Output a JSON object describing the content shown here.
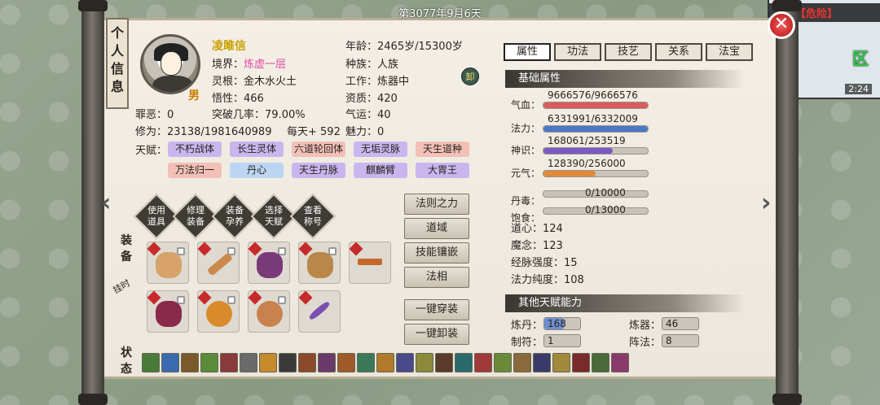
{
  "date": "第3077年9月6天",
  "minimap": {
    "area_name": "裂隙",
    "danger": "【危险】",
    "zone": "区",
    "time": "2:24"
  },
  "side_tags": {
    "info": "个人信息",
    "equip": "装备",
    "status": "状态"
  },
  "character": {
    "name": "凌雎信",
    "gender": "男",
    "realm_label": "境界：",
    "realm": "炼虚一层",
    "root_label": "灵根：",
    "root": "金木水火土",
    "comprehension_label": "悟性：",
    "comprehension": "466",
    "sin_label": "罪恶：",
    "sin": "0",
    "breakthrough_label": "突破几率：",
    "breakthrough": "79.00%",
    "cultivation_label": "修为：",
    "cultivation": "23138/1981640989",
    "per_day": "每天+ 592",
    "age_label": "年龄：",
    "age": "2465岁/15300岁",
    "race_label": "种族：",
    "race": "人族",
    "work_label": "工作：",
    "work": "炼器中",
    "aptitude_label": "资质：",
    "aptitude": "420",
    "luck_label": "气运：",
    "luck": "40",
    "charm_label": "魅力：",
    "charm": "0",
    "unequip_btn": "卸"
  },
  "talents_label": "天赋：",
  "talents": [
    {
      "name": "不朽战体",
      "color": "purple"
    },
    {
      "name": "长生灵体",
      "color": "purple"
    },
    {
      "name": "六道轮回体",
      "color": "red"
    },
    {
      "name": "无垢灵脉",
      "color": "purple"
    },
    {
      "name": "天生道种",
      "color": "red"
    },
    {
      "name": "万法归一",
      "color": "red"
    },
    {
      "name": "丹心",
      "color": "blue"
    },
    {
      "name": "天生丹脉",
      "color": "purple"
    },
    {
      "name": "麒麟臂",
      "color": "purple"
    },
    {
      "name": "大胃王",
      "color": "purple"
    }
  ],
  "diamond_buttons": [
    {
      "label": "使用道具"
    },
    {
      "label": "修理装备"
    },
    {
      "label": "装备孕养"
    },
    {
      "label": "选择天赋"
    },
    {
      "label": "查看称号"
    }
  ],
  "action_buttons": [
    "法则之力",
    "道域",
    "技能镶嵌",
    "法相",
    "一键穿装",
    "一键卸装"
  ],
  "tabs": [
    {
      "label": "属性",
      "active": true
    },
    {
      "label": "功法",
      "active": false
    },
    {
      "label": "技艺",
      "active": false
    },
    {
      "label": "关系",
      "active": false
    },
    {
      "label": "法宝",
      "active": false
    }
  ],
  "basic_title": "基础属性",
  "bars": [
    {
      "label": "气血：",
      "value": "9666576/9666576",
      "fraction": 1.0,
      "color": "#d95b5b"
    },
    {
      "label": "法力：",
      "value": "6331991/6332009",
      "fraction": 0.999,
      "color": "#4b77c9"
    },
    {
      "label": "神识：",
      "value": "168061/253519",
      "fraction": 0.663,
      "color": "#7b58c4"
    },
    {
      "label": "元气：",
      "value": "128390/256000",
      "fraction": 0.5,
      "color": "#e08a3c"
    },
    {
      "label": "丹毒：",
      "value": "0/10000",
      "fraction": 0,
      "color": "#888"
    },
    {
      "label": "饱食：",
      "value": "0/13000",
      "fraction": 0,
      "color": "#888"
    }
  ],
  "plain_stats": [
    {
      "label": "道心：",
      "value": "124"
    },
    {
      "label": "魔念：",
      "value": "123"
    },
    {
      "label": "经脉强度：",
      "value": "15"
    },
    {
      "label": "法力纯度：",
      "value": "108"
    }
  ],
  "other_title": "其他天赋能力",
  "skills": [
    {
      "label": "炼丹：",
      "value": "168",
      "fraction": 0.55
    },
    {
      "label": "炼器：",
      "value": "46",
      "fraction": 0
    },
    {
      "label": "制符：",
      "value": "1",
      "fraction": 0
    },
    {
      "label": "阵法：",
      "value": "8",
      "fraction": 0
    }
  ]
}
